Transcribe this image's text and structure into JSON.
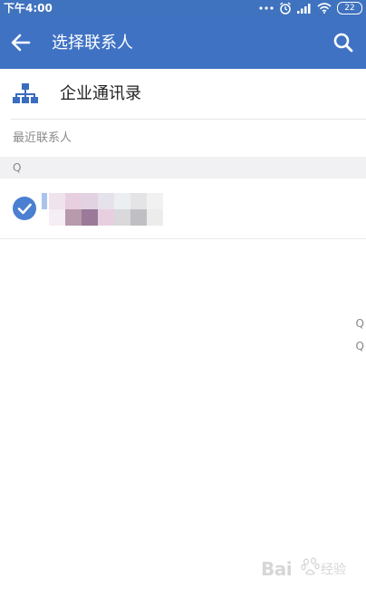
{
  "status_bar": {
    "time": "下午4:00",
    "battery": "22"
  },
  "toolbar": {
    "title": "选择联系人"
  },
  "org_directory": {
    "label": "企业通讯录"
  },
  "recent": {
    "label": "最近联系人"
  },
  "section": {
    "letter": "Q"
  },
  "contacts": [
    {
      "name": "",
      "selected": true
    }
  ],
  "index_bar": {
    "letters": [
      "Q",
      "Q"
    ]
  },
  "watermark": {
    "text": "Bai",
    "suffix": "经验"
  },
  "colors": {
    "toolbar": "#4072c4",
    "status_bar": "#3f72bf",
    "check": "#4a7fd1",
    "org_icon": "#3a6cc0"
  }
}
